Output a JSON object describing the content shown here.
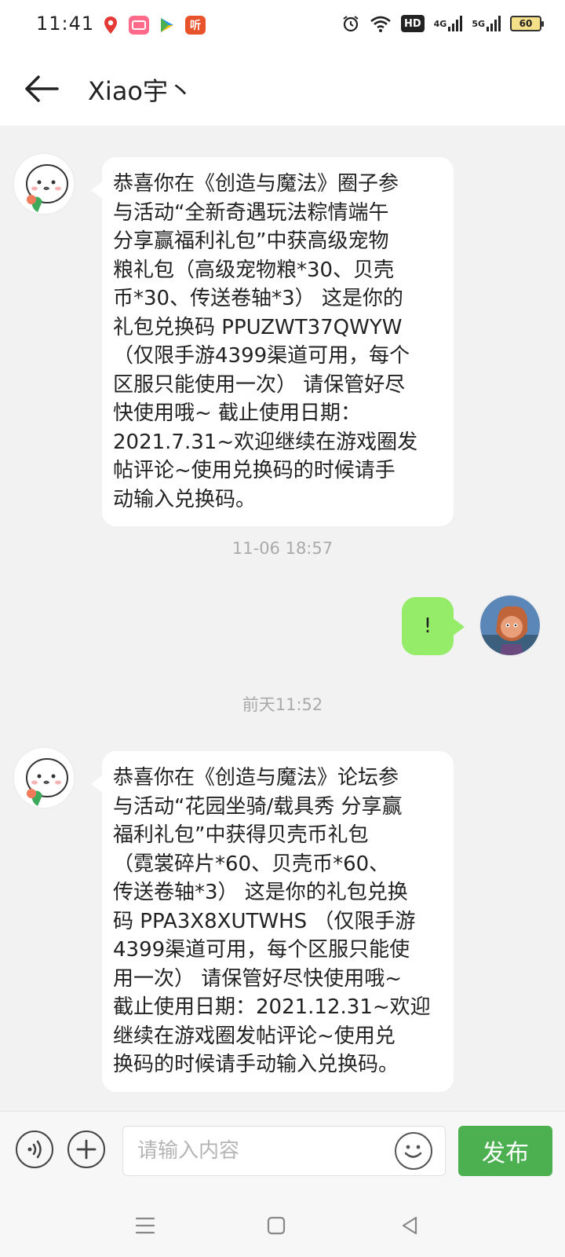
{
  "status_bar": {
    "time": "11:41",
    "battery_level": "60",
    "signal_1_label": "4G",
    "signal_2_label": "5G",
    "hd_label": "HD",
    "apps": [
      "map-pin-icon",
      "video-app-icon",
      "play-store-icon",
      "listen-app-icon"
    ],
    "listen_app_label": "听"
  },
  "header": {
    "title": "Xiao宇丶"
  },
  "messages": [
    {
      "direction": "incoming",
      "text": "恭喜你在《创造与魔法》圈子参与活动“全新奇遇玩法粽情端午分享赢福利礼包”中获高级宠物粮礼包（高级宠物粮*30、贝壳币*30、传送卷轴*3） 这是你的礼包兑换码 PPUZWT37QWYW （仅限手游4399渠道可用，每个区服只能使用一次） 请保管好尽快使用哦~ 截止使用日期：2021.7.31~欢迎继续在游戏圈发帖评论~使用兑换码的时候请手动输入兑换码。",
      "lines": [
        "恭喜你在《创造与魔法》圈子参",
        "与活动“全新奇遇玩法粽情端午",
        "分享赢福利礼包”中获高级宠物",
        "粮礼包（高级宠物粮*30、贝壳",
        "币*30、传送卷轴*3） 这是你的",
        "礼包兑换码 PPUZWT37QWYW",
        "（仅限手游4399渠道可用，每个",
        "区服只能使用一次） 请保管好尽",
        "快使用哦~ 截止使用日期：",
        "2021.7.31~欢迎继续在游戏圈发",
        "帖评论~使用兑换码的时候请手",
        "动输入兑换码。"
      ]
    },
    {
      "direction": "timestamp",
      "text": "11-06 18:57"
    },
    {
      "direction": "outgoing",
      "text": "!"
    },
    {
      "direction": "timestamp",
      "text": "前天11:52"
    },
    {
      "direction": "incoming",
      "text": "恭喜你在《创造与魔法》论坛参与活动“花园坐骑/载具秀 分享赢福利礼包”中获得贝壳币礼包（霓裳碎片*60、贝壳币*60、传送卷轴*3） 这是你的礼包兑换码 PPA3X8XUTWHS （仅限手游4399渠道可用，每个区服只能使用一次） 请保管好尽快使用哦~ 截止使用日期：2021.12.31~欢迎继续在游戏圈发帖评论~使用兑换码的时候请手动输入兑换码。",
      "lines": [
        "恭喜你在《创造与魔法》论坛参",
        "与活动“花园坐骑/载具秀 分享赢",
        "福利礼包”中获得贝壳币礼包",
        "（霓裳碎片*60、贝壳币*60、",
        "传送卷轴*3） 这是你的礼包兑换",
        "码 PPA3X8XUTWHS （仅限手游",
        "4399渠道可用，每个区服只能使",
        "用一次） 请保管好尽快使用哦~",
        "截止使用日期：2021.12.31~欢迎",
        "继续在游戏圈发帖评论~使用兑",
        "换码的时候请手动输入兑换码。"
      ]
    }
  ],
  "input_bar": {
    "placeholder": "请输入内容",
    "value": "",
    "send_label": "发布"
  },
  "colors": {
    "outgoing_bubble": "#95ec69",
    "send_button": "#4caf50",
    "background": "#f2f2f2"
  }
}
